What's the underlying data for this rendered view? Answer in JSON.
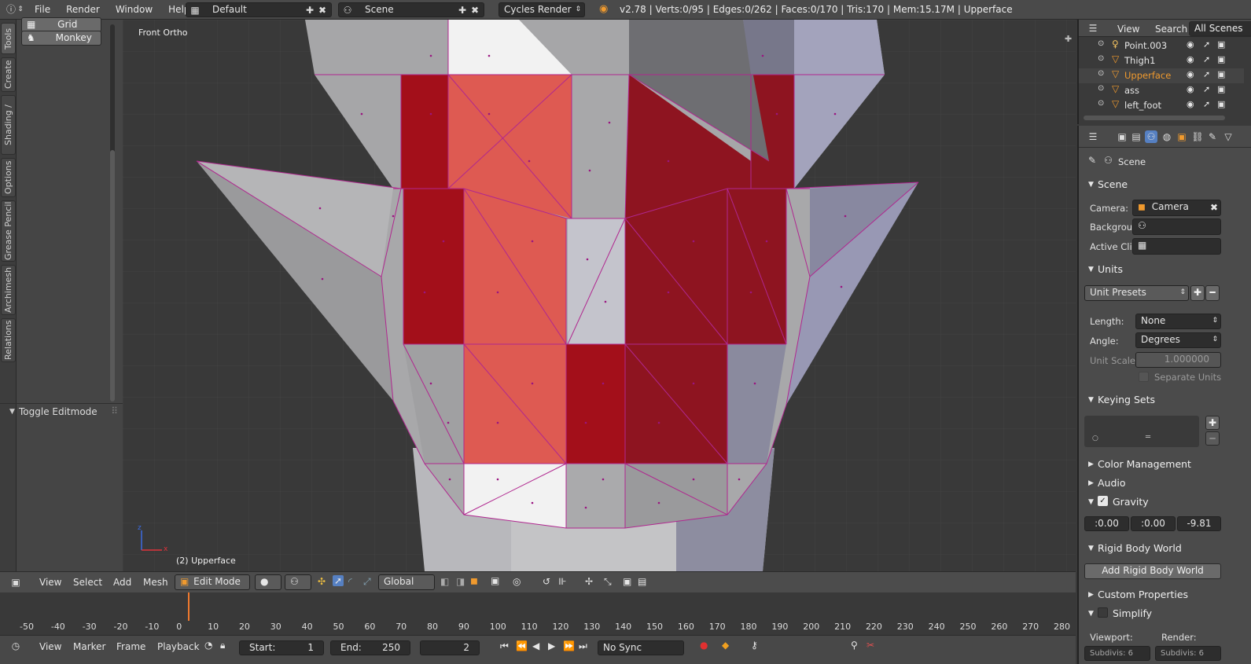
{
  "topbar": {
    "menus": [
      "File",
      "Render",
      "Window",
      "Help"
    ],
    "layout": "Default",
    "scene": "Scene",
    "engine": "Cycles Render",
    "stats": "v2.78 | Verts:0/95 | Edges:0/262 | Faces:0/170 | Tris:170 | Mem:15.17M | Upperface"
  },
  "tabs": [
    "Tools",
    "Create",
    "Shading / UVs",
    "Options",
    "Grease Pencil",
    "Archimesh",
    "Relations"
  ],
  "toolshelf": {
    "items": [
      "Grid",
      "Monkey"
    ],
    "operator": "Toggle Editmode"
  },
  "viewport": {
    "view_name": "Front Ortho",
    "object_label": "(2) Upperface"
  },
  "outliner": {
    "menu": [
      "View",
      "Search"
    ],
    "filter": "All Scenes",
    "items": [
      "Point.003",
      "Thigh1",
      "Upperface",
      "ass",
      "left_foot"
    ]
  },
  "properties": {
    "context": "Scene",
    "scene_panel": {
      "title": "Scene",
      "camera_label": "Camera:",
      "camera_value": "Camera",
      "background_label": "Backgrou",
      "active_clip_label": "Active Cli"
    },
    "units_panel": {
      "title": "Units",
      "presets": "Unit Presets",
      "length_label": "Length:",
      "length_value": "None",
      "angle_label": "Angle:",
      "angle_value": "Degrees",
      "scale_label": "Unit Scale",
      "scale_value": "1.000000",
      "separate": "Separate Units"
    },
    "keying_sets": "Keying Sets",
    "color_management": "Color Management",
    "audio": "Audio",
    "gravity": {
      "title": "Gravity",
      "x": ":0.00",
      "y": ":0.00",
      "z": "-9.81"
    },
    "rigid_body": {
      "title": "Rigid Body World",
      "button": "Add Rigid Body World"
    },
    "custom_props": "Custom Properties",
    "simplify": "Simplify",
    "viewport_label": "Viewport:",
    "render_label": "Render:",
    "subdiv_left": "Subdivis: 6",
    "subdiv_right": "Subdivis: 6"
  },
  "view3d_header": {
    "menus": [
      "View",
      "Select",
      "Add",
      "Mesh"
    ],
    "mode": "Edit Mode",
    "orientation": "Global"
  },
  "timeline": {
    "ticks": [
      "-50",
      "-40",
      "-30",
      "-20",
      "-10",
      "0",
      "10",
      "20",
      "30",
      "40",
      "50",
      "60",
      "70",
      "80",
      "90",
      "100",
      "110",
      "120",
      "130",
      "140",
      "150",
      "160",
      "170",
      "180",
      "190",
      "200",
      "210",
      "220",
      "230",
      "240",
      "250",
      "260",
      "270",
      "280"
    ],
    "current_frame": 2
  },
  "timeline_footer": {
    "menus": [
      "View",
      "Marker",
      "Frame",
      "Playback"
    ],
    "start_label": "Start:",
    "start_value": "1",
    "end_label": "End:",
    "end_value": "250",
    "frame_value": "2",
    "sync": "No Sync"
  },
  "colors": {
    "selected_face_dark": "#a30f1a",
    "selected_face_light": "#de5a52",
    "edge_select": "#b0278f",
    "active_object": "#f09a2e"
  }
}
